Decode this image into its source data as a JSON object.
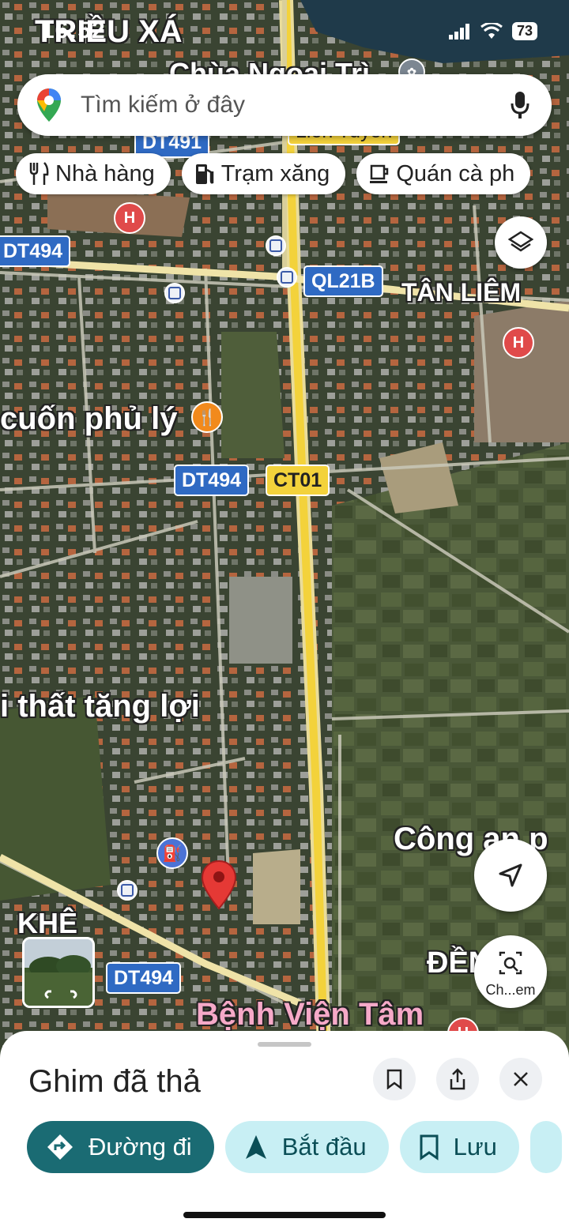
{
  "status_bar": {
    "time": "16:52",
    "battery": "73"
  },
  "search": {
    "placeholder": "Tìm kiếm ở đây"
  },
  "chips": [
    {
      "label": "Nhà hàng",
      "icon": "fork-knife-icon"
    },
    {
      "label": "Trạm xăng",
      "icon": "gas-station-icon"
    },
    {
      "label": "Quán cà ph",
      "icon": "coffee-cup-icon"
    }
  ],
  "map": {
    "area_labels": {
      "trieu_xa": "TRIỀU XÁ",
      "chua_ngoai_tri": "Chùa Ngoại Trì",
      "tan_liem": "TÂN LIÊM",
      "banh_cuon": "cuốn phủ lý",
      "noi_that": "i thất tăng lợi",
      "cong_an": "Công an p",
      "khe": "KHÊ",
      "den": "ĐỀN",
      "benh_vien": "Bệnh Viện Tâm"
    },
    "road_shields": {
      "dt491": "DT491",
      "lien_tuyen": "Liên Tuyến",
      "dt494_left": "DT494",
      "ql21b": "QL21B",
      "dt494_mid": "DT494",
      "ct01": "CT01",
      "dt494_bottom": "DT494"
    },
    "colors": {
      "road_yellow": "#f3d23b",
      "shield_blue": "#2f6ac3",
      "pin_red": "#e53935"
    }
  },
  "explore": {
    "label": "Ch...em"
  },
  "sheet": {
    "title": "Ghim đã thả",
    "actions": [
      {
        "label": "Đường đi",
        "icon": "directions-icon"
      },
      {
        "label": "Bắt đầu",
        "icon": "navigation-arrow-icon"
      },
      {
        "label": "Lưu",
        "icon": "bookmark-icon"
      }
    ]
  }
}
